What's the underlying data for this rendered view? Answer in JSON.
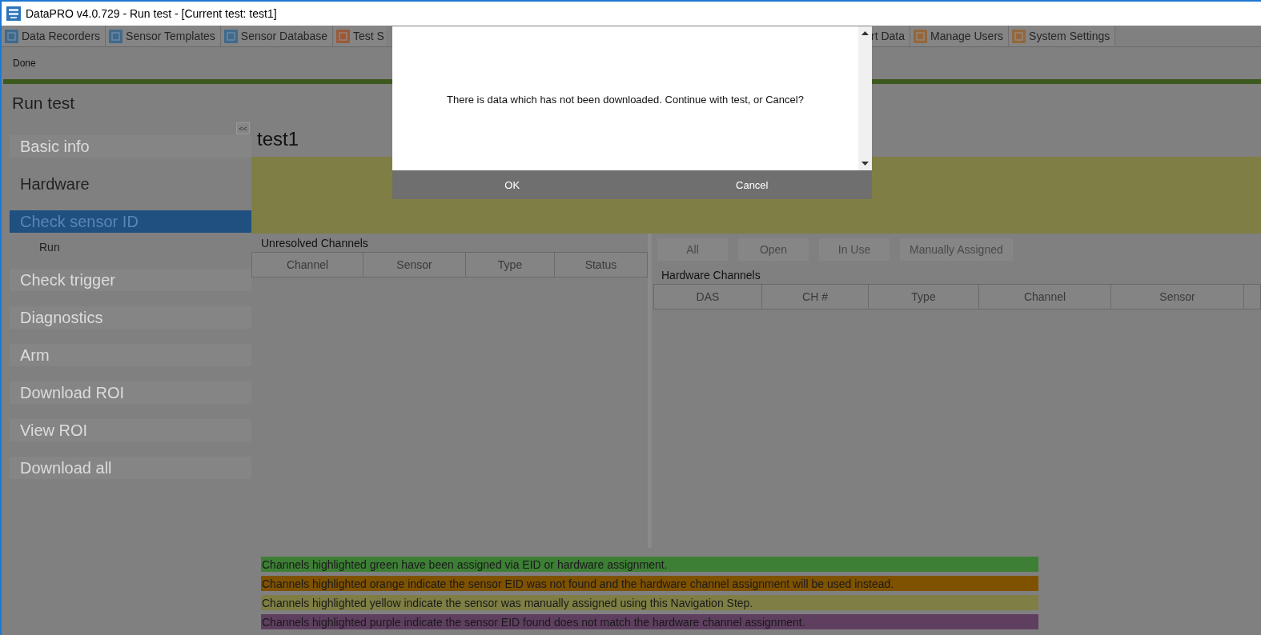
{
  "window": {
    "title": "DataPRO v4.0.729 - Run test - [Current test: test1]"
  },
  "tabs": [
    {
      "label": "Data Recorders",
      "kind": "recorder"
    },
    {
      "label": "Sensor Templates",
      "kind": "template"
    },
    {
      "label": "Sensor Database",
      "kind": "database"
    },
    {
      "label": "Test S",
      "kind": "tools"
    },
    {
      "label": "rt Data",
      "kind": "hidden"
    },
    {
      "label": "Manage Users",
      "kind": "users"
    },
    {
      "label": "System Settings",
      "kind": "settings"
    }
  ],
  "toolbar": {
    "buttons": [
      "Done"
    ]
  },
  "sidebar": {
    "title": "Run test",
    "collapse": "<<",
    "items": [
      {
        "label": "Basic info",
        "selected": false,
        "available": false
      },
      {
        "label": "Hardware",
        "selected": false,
        "available": true
      },
      {
        "label": "Check sensor ID",
        "selected": true,
        "available": false,
        "children": [
          {
            "label": "Run"
          }
        ]
      },
      {
        "label": "Check trigger",
        "selected": false,
        "available": false
      },
      {
        "label": "Diagnostics",
        "selected": false,
        "available": false
      },
      {
        "label": "Arm",
        "selected": false,
        "available": false
      },
      {
        "label": "Download ROI",
        "selected": false,
        "available": false
      },
      {
        "label": "View ROI",
        "selected": false,
        "available": false
      },
      {
        "label": "Download all",
        "selected": false,
        "available": false
      }
    ]
  },
  "content": {
    "title": "test1",
    "unresolved": {
      "title": "Unresolved Channels",
      "columns": [
        "Channel",
        "Sensor",
        "Type",
        "Status"
      ]
    },
    "filters": [
      {
        "label": "All",
        "selected": false
      },
      {
        "label": "Open",
        "selected": false
      },
      {
        "label": "In Use",
        "selected": false
      },
      {
        "label": "Manually Assigned",
        "selected": false
      }
    ],
    "hardware": {
      "title": "Hardware Channels",
      "columns": [
        "DAS",
        "CH #",
        "Type",
        "Channel",
        "Sensor"
      ]
    },
    "legend": [
      {
        "text": "Channels highlighted green have been assigned via EID or hardware assignment.",
        "color": "#3d7f35"
      },
      {
        "text": "Channels highlighted orange indicate the sensor EID was not found and the hardware channel assignment will be used instead.",
        "color": "#7f5200"
      },
      {
        "text": "Channels highlighted yellow indicate the sensor was manually assigned using this Navigation Step.",
        "color": "#7f7f45"
      },
      {
        "text": "Channels highlighted purple indicate the sensor EID found does not match the hardware channel assignment.",
        "color": "#5f3f60"
      }
    ]
  },
  "dialog": {
    "message": "There is data which has not been downloaded.  Continue with test, or Cancel?",
    "buttons": [
      "OK",
      "Cancel"
    ]
  }
}
